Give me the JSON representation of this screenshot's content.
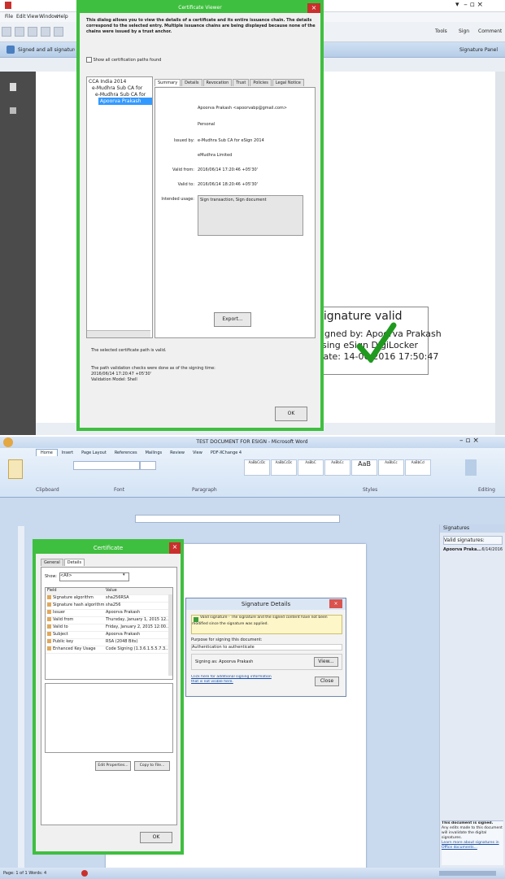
{
  "top": {
    "app_menu": [
      "File",
      "Edit",
      "View",
      "Window",
      "Help"
    ],
    "toolbar_right": [
      "Tools",
      "Sign",
      "Comment"
    ],
    "sigbar_text": "Signed and all signatures are valid",
    "signature_panel_btn": "Signature Panel",
    "cert_viewer": {
      "title": "Certificate Viewer",
      "intro": "This dialog allows you to view the details of a certificate and its entire issuance chain. The details correspond to the selected entry. Multiple issuance chains are being displayed because none of the chains were issued by a trust anchor.",
      "show_all_label": "Show all certification paths found",
      "tree": [
        "CCA India 2014",
        "e-Mudhra Sub CA for",
        "e-Mudhra Sub CA for",
        "Apoorva Prakash"
      ],
      "tabs": [
        "Summary",
        "Details",
        "Revocation",
        "Trust",
        "Policies",
        "Legal Notice"
      ],
      "summary": [
        {
          "label": "",
          "value": "Apoorva Prakash <apoorvabp@gmail.com>"
        },
        {
          "label": "",
          "value": "Personal"
        },
        {
          "label": "Issued by:",
          "value": "e-Mudhra Sub CA for eSign 2014"
        },
        {
          "label": "",
          "value": "eMudhra Limited"
        },
        {
          "label": "Valid from:",
          "value": "2016/06/14 17:20:46 +05'30'"
        },
        {
          "label": "Valid to:",
          "value": "2016/06/14 18:20:46 +05'30'"
        },
        {
          "label": "Intended usage:",
          "value": "Sign transaction, Sign document"
        }
      ],
      "export_btn": "Export...",
      "status1": "The selected certificate path is valid.",
      "status2": "The path validation checks were done as of the signing time:",
      "status3": "2016/06/14 17:20:47 +05'30'",
      "status4": "Validation Model: Shell",
      "ok_btn": "OK"
    },
    "signature_box": {
      "line1": "Signature valid",
      "line2": "Signed by: Apoorva Prakash",
      "line3": "using eSign DigiLocker",
      "line4": "Date: 14-06-2016 17:50:47"
    }
  },
  "bottom": {
    "word_title": "TEST DOCUMENT FOR ESIGN - Microsoft Word",
    "ribbon_tabs": [
      "Home",
      "Insert",
      "Page Layout",
      "References",
      "Mailings",
      "Review",
      "View",
      "PDF-XChange 4"
    ],
    "style_names": [
      "AaBbCcDc",
      "AaBbCcDc",
      "AaBbC",
      "AaBbCc",
      "AaB",
      "AaBbCc",
      "AaBbCcl"
    ],
    "group_labels": [
      "Clipboard",
      "Font",
      "Paragraph",
      "Styles",
      "Editing"
    ],
    "certificate": {
      "title": "Certificate",
      "tabs": [
        "General",
        "Details"
      ],
      "show_label": "Show:",
      "show_value": "<All>",
      "col_field": "Field",
      "col_value": "Value",
      "rows": [
        {
          "field": "Signature algorithm",
          "value": "sha256RSA"
        },
        {
          "field": "Signature hash algorithm",
          "value": "sha256"
        },
        {
          "field": "Issuer",
          "value": "Apoorva Prakash"
        },
        {
          "field": "Valid from",
          "value": "Thursday, January 1, 2015 12..."
        },
        {
          "field": "Valid to",
          "value": "Friday, January 2, 2015 12:00..."
        },
        {
          "field": "Subject",
          "value": "Apoorva Prakash"
        },
        {
          "field": "Public key",
          "value": "RSA (2048 Bits)"
        },
        {
          "field": "Enhanced Key Usage",
          "value": "Code Signing (1.3.6.1.5.5.7.3..."
        }
      ],
      "edit_props_btn": "Edit Properties...",
      "copy_btn": "Copy to File...",
      "ok_btn": "OK"
    },
    "sig_details": {
      "title": "Signature Details",
      "warning": "Valid signature - The signature and the signed content have not been modified since the signature was applied.",
      "purpose_label": "Purpose for signing this document:",
      "purpose_value": "Authentication to authenticate",
      "signing_as": "Signing as:   Apoorva Prakash",
      "view_btn": "View...",
      "link1": "Click here for additional signing information",
      "link2": "that is not visible here.",
      "close_btn": "Close"
    },
    "sig_pane": {
      "title": "Signatures",
      "valid_header": "Valid signatures:",
      "signer": "Apoorva Praka...",
      "signer_date": "6/14/2016",
      "bottom_title": "This document is signed.",
      "bottom_text1": "Any edits made to this document will invalidate the digital signatures.",
      "bottom_text2": "Learn more about signatures in Office documents..."
    },
    "status_bar": "Page: 1 of 1   Words: 4"
  },
  "colors": {
    "dialog_border": "#3fbf3f",
    "check": "#1f9a1f"
  }
}
